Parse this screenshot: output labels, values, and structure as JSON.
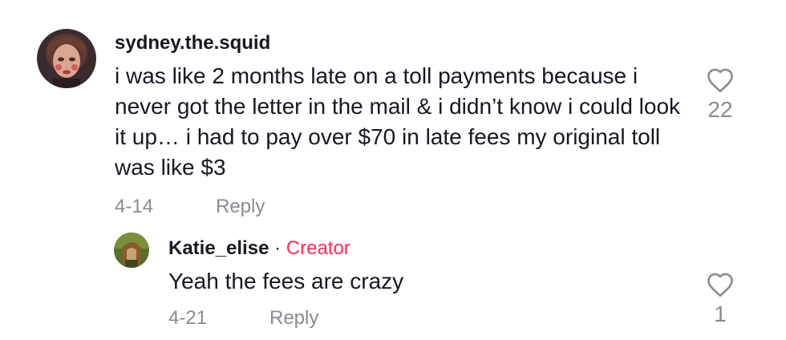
{
  "comments": [
    {
      "username": "sydney.the.squid",
      "text": "i was like 2 months late on a toll payments because i never got the letter in the mail & i didn’t know i could look it up… i had to pay over $70 in late fees my original toll was like $3",
      "date": "4-14",
      "reply_label": "Reply",
      "like_count": "22",
      "like_icon": "heart-outline-icon"
    }
  ],
  "replies": [
    {
      "username": "Katie_elise",
      "separator": "·",
      "badge": "Creator",
      "text": "Yeah the fees are crazy",
      "date": "4-21",
      "reply_label": "Reply",
      "like_count": "1",
      "like_icon": "heart-outline-icon"
    }
  ],
  "colors": {
    "primary_text": "#161823",
    "secondary_text": "#8a8b91",
    "creator_badge": "#fe2c55"
  }
}
